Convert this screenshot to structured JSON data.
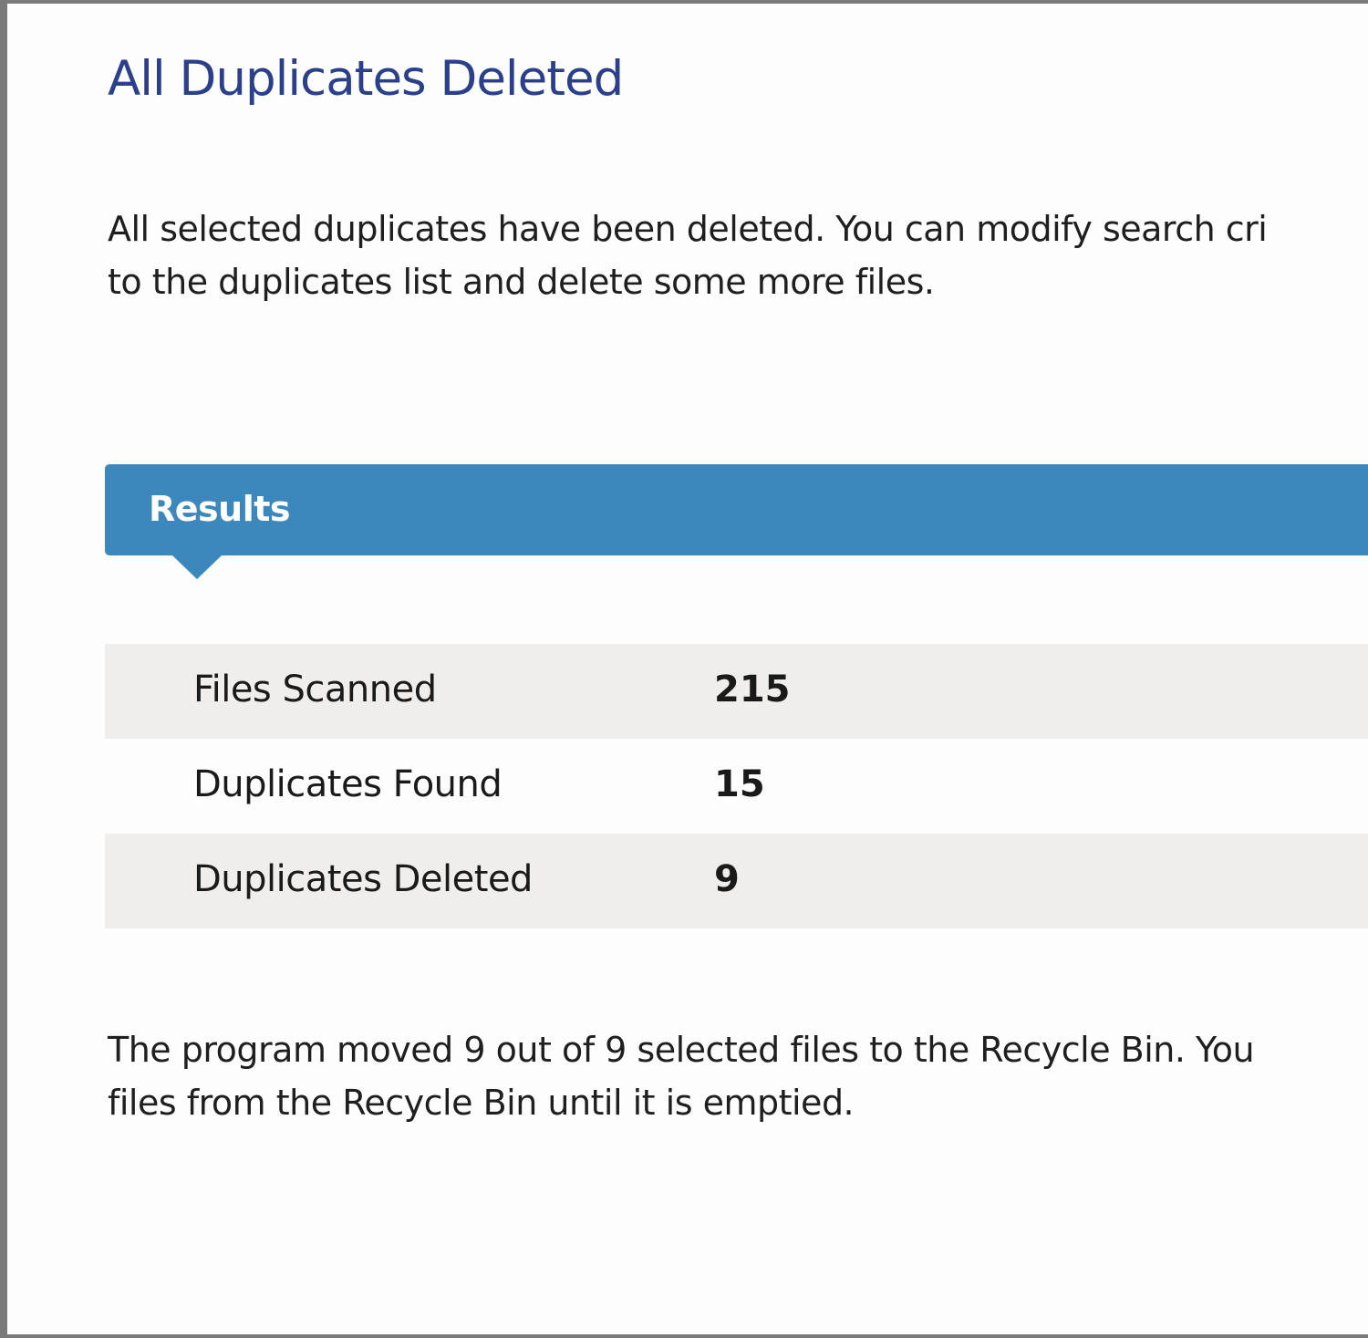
{
  "page": {
    "title": "All Duplicates Deleted",
    "description_lines": [
      "All selected duplicates have been deleted. You can modify search cri",
      "to the duplicates list and delete some more files."
    ],
    "footer_lines": [
      "The program moved 9 out of 9 selected files to the Recycle Bin. You",
      "files from the Recycle Bin until it is emptied."
    ]
  },
  "results": {
    "header": "Results",
    "rows": [
      {
        "label": "Files Scanned",
        "value": "215"
      },
      {
        "label": "Duplicates Found",
        "value": "15"
      },
      {
        "label": "Duplicates Deleted",
        "value": "9"
      }
    ]
  },
  "colors": {
    "title": "#2b3f8a",
    "header_background": "#3c87bb",
    "row_shade": "#efeeec"
  }
}
